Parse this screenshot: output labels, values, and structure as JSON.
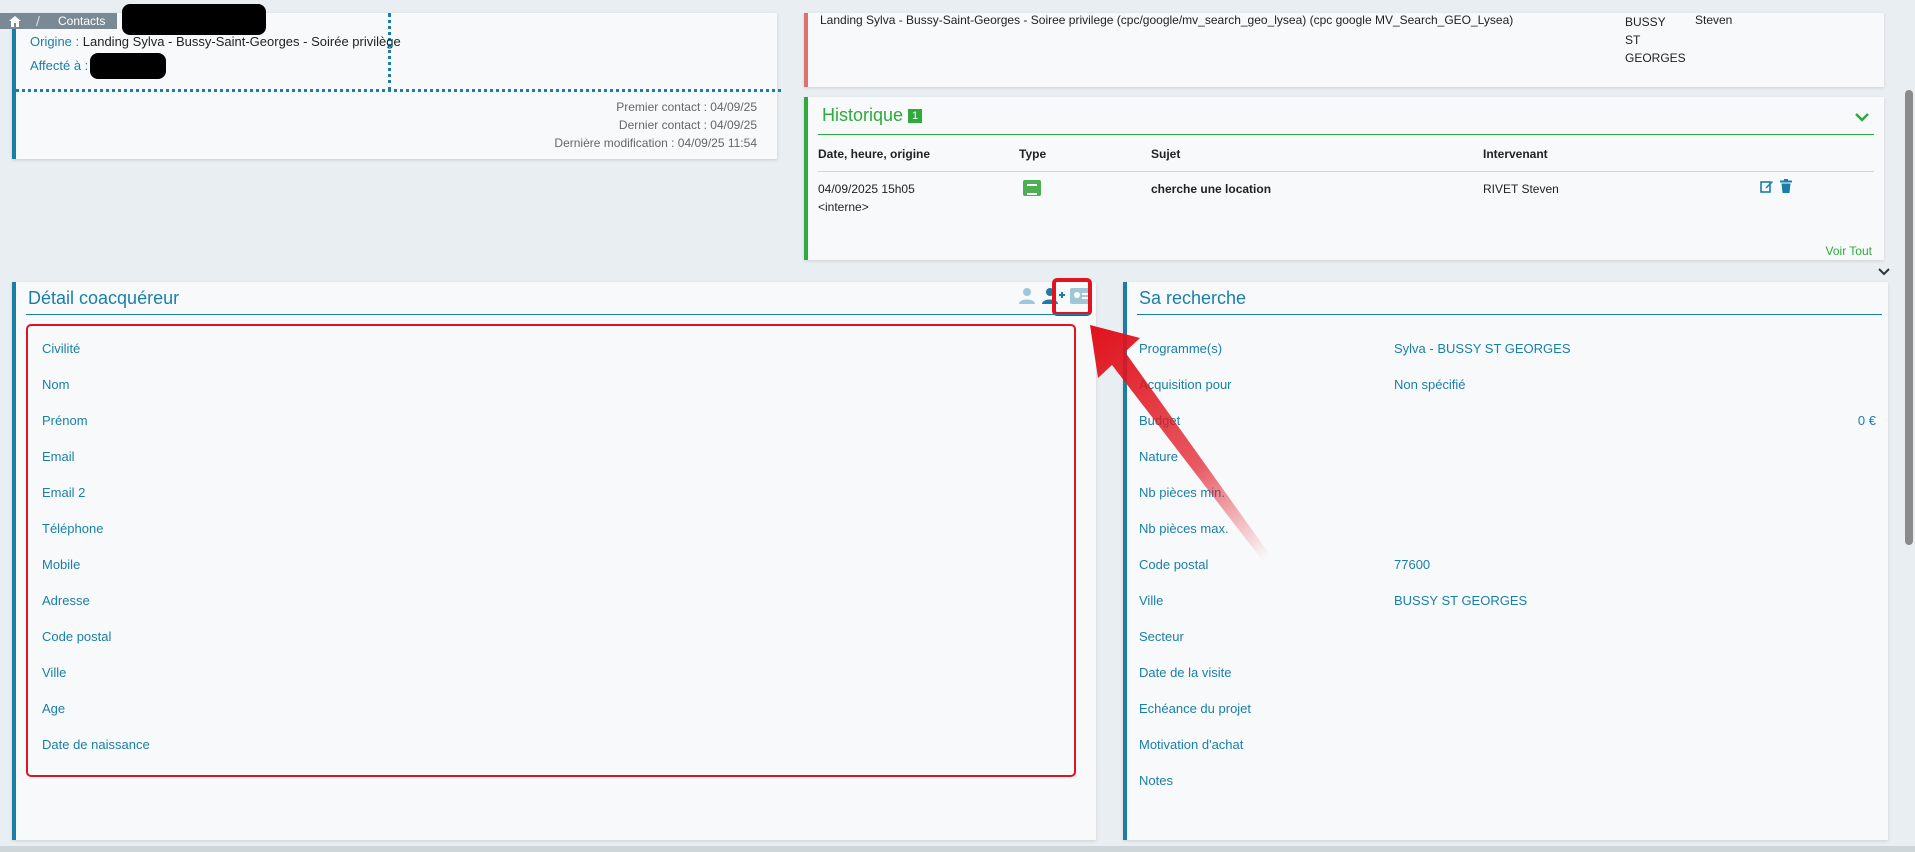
{
  "breadcrumb": {
    "home_icon": "home-icon",
    "contacts_label": "Contacts"
  },
  "contact": {
    "origine_label": "Origine :",
    "origine_value": "Landing Sylva - Bussy-Saint-Georges - Soirée privilège",
    "affecte_label": "Affecté à :",
    "premier_contact": "Premier contact : 04/09/25",
    "dernier_contact": "Dernier contact : 04/09/25",
    "derniere_modification": "Dernière modification : 04/09/25 11:54"
  },
  "top_right": {
    "text": "Landing Sylva - Bussy-Saint-Georges - Soiree privilege (cpc/google/mv_search_geo_lysea) (cpc google MV_Search_GEO_Lysea)",
    "city_lines": [
      "BUSSY",
      "ST",
      "GEORGES"
    ],
    "intervenant": "Steven"
  },
  "historique": {
    "title": "Historique",
    "count": "1",
    "columns": [
      "Date, heure, origine",
      "Type",
      "Sujet",
      "Intervenant"
    ],
    "rows": [
      {
        "date": "04/09/2025 15h05",
        "origin": "<interne>",
        "subject": "cherche une location",
        "intervenant": "RIVET Steven"
      }
    ],
    "voir_tout": "Voir Tout"
  },
  "coacquereur": {
    "title": "Détail coacquéreur",
    "fields": [
      "Civilité",
      "Nom",
      "Prénom",
      "Email",
      "Email 2",
      "Téléphone",
      "Mobile",
      "Adresse",
      "Code postal",
      "Ville",
      "Age",
      "Date de naissance"
    ]
  },
  "recherche": {
    "title": "Sa recherche",
    "rows": [
      {
        "label": "Programme(s)",
        "value": "Sylva - BUSSY ST GEORGES"
      },
      {
        "label": "Acquisition pour",
        "value": "Non spécifié"
      },
      {
        "label": "Budget",
        "value_right": "0 €"
      },
      {
        "label": "Nature"
      },
      {
        "label": "Nb pièces min."
      },
      {
        "label": "Nb pièces max."
      },
      {
        "label": "Code postal",
        "value": "77600"
      },
      {
        "label": "Ville",
        "value": "BUSSY ST GEORGES"
      },
      {
        "label": "Secteur"
      },
      {
        "label": "Date de la visite"
      },
      {
        "label": "Echéance du projet"
      },
      {
        "label": "Motivation d'achat"
      },
      {
        "label": "Notes"
      }
    ]
  },
  "colors": {
    "accent_blue": "#1a7fa7",
    "historique_green": "#2faa3e",
    "highlight_red": "#e0141e"
  }
}
